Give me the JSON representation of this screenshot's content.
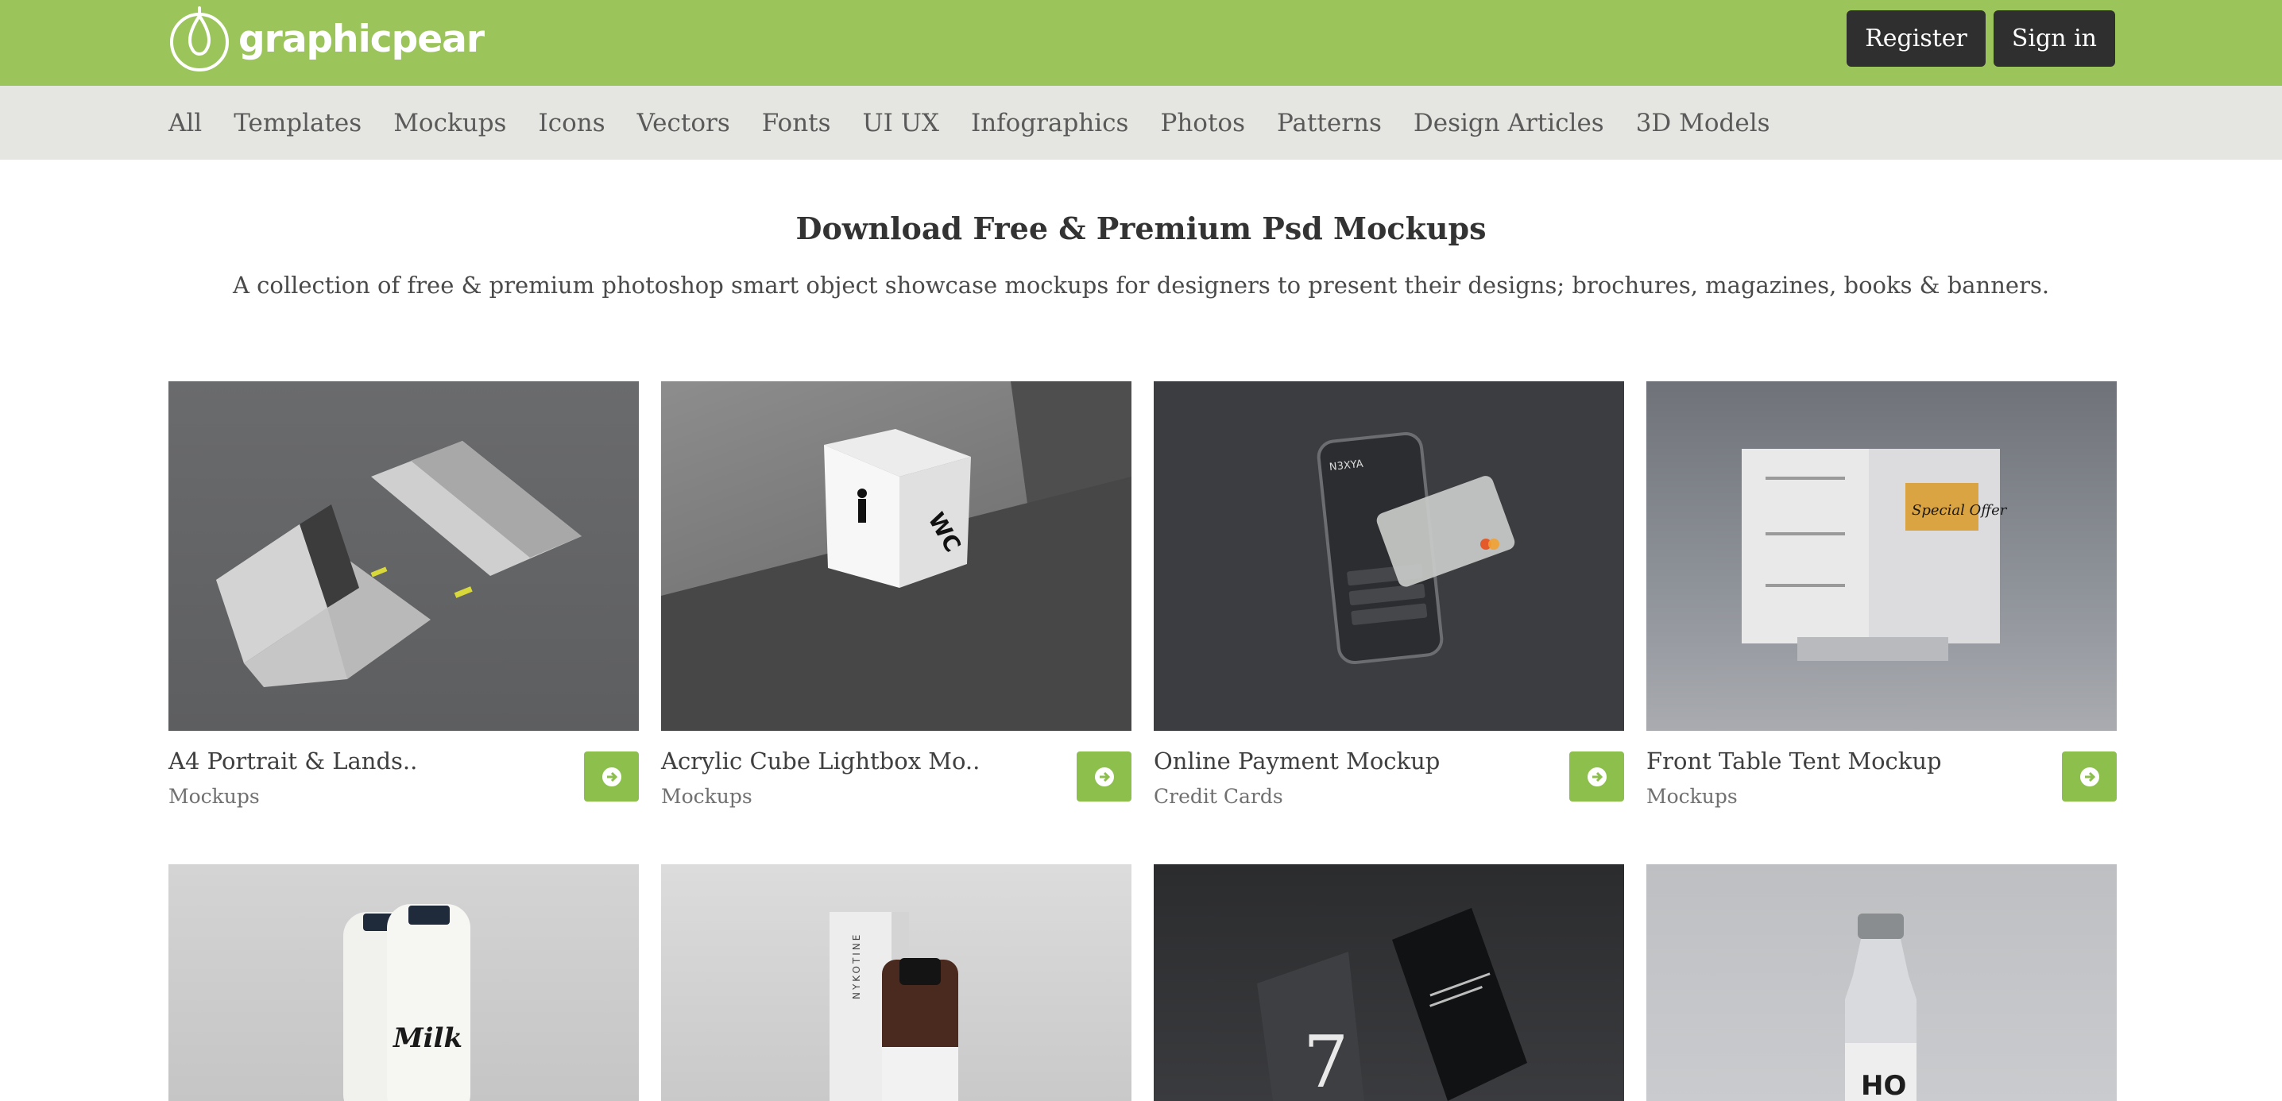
{
  "brand": {
    "name": "graphicpear",
    "accent": "#9bc45a"
  },
  "header": {
    "register_label": "Register",
    "signin_label": "Sign in"
  },
  "nav": {
    "items": [
      "All",
      "Templates",
      "Mockups",
      "Icons",
      "Vectors",
      "Fonts",
      "UI UX",
      "Infographics",
      "Photos",
      "Patterns",
      "Design Articles",
      "3D Models"
    ]
  },
  "page": {
    "title": "Download Free & Premium Psd Mockups",
    "subtitle": "A collection of free & premium photoshop smart object showcase mockups for designers to present their designs; brochures, magazines, books & banners."
  },
  "cards": [
    {
      "title": "A4 Portrait & Lands..",
      "category": "Mockups"
    },
    {
      "title": "Acrylic Cube Lightbox Mo..",
      "category": "Mockups",
      "thumb_text": "WC"
    },
    {
      "title": "Online Payment Mockup",
      "category": "Credit Cards",
      "thumb_text": "N3XYA"
    },
    {
      "title": "Front Table Tent Mockup",
      "category": "Mockups",
      "thumb_text": "Special Offer"
    },
    {
      "title": "",
      "category": "",
      "thumb_text": "Milk"
    },
    {
      "title": "",
      "category": "",
      "thumb_text": "NYKOTINE"
    },
    {
      "title": "",
      "category": "",
      "thumb_text": "7"
    },
    {
      "title": "",
      "category": "",
      "thumb_text": "HO"
    }
  ]
}
